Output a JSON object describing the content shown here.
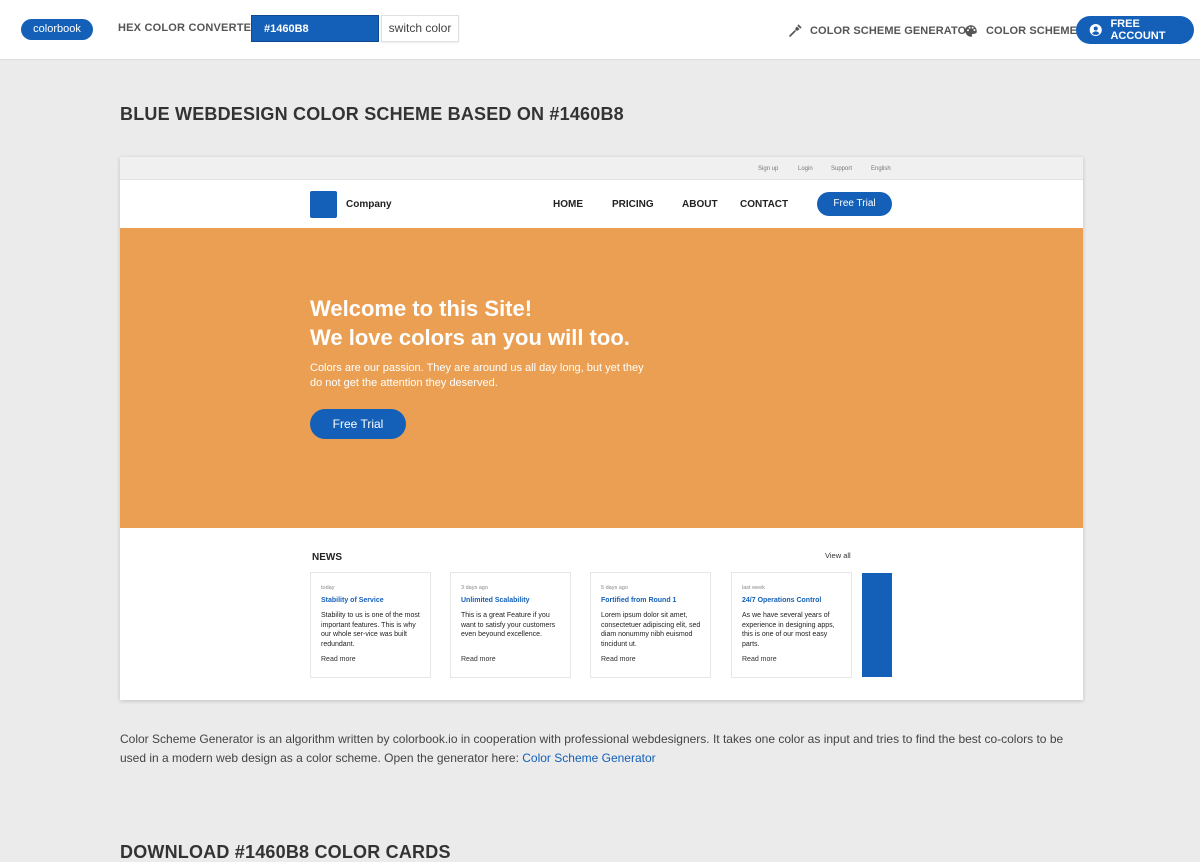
{
  "topnav": {
    "logo": "colorbook",
    "converter_label": "HEX COLOR CONVERTER",
    "hex_value": "#1460B8",
    "switch_label": "switch color",
    "scheme_generator": "COLOR SCHEME GENERATOR",
    "color_schemes": "COLOR SCHEMES",
    "free_account": "FREE ACCOUNT"
  },
  "page_title": "BLUE WEBDESIGN COLOR SCHEME BASED ON #1460B8",
  "preview": {
    "util_links": [
      "Sign up",
      "Login",
      "Support",
      "English"
    ],
    "brand": "Company",
    "nav": [
      "HOME",
      "PRICING",
      "ABOUT",
      "CONTACT"
    ],
    "nav_cta": "Free Trial",
    "hero_title_1": "Welcome to this Site!",
    "hero_title_2": "We love colors an you will too.",
    "hero_text": "Colors are our passion. They are around us all day long, but yet they do not get the attention they deserved.",
    "hero_button": "Free Trial",
    "news_heading": "NEWS",
    "view_all": "View all",
    "cards": [
      {
        "date": "today",
        "title": "Stability of Service",
        "text": "Stability to us is one of the most important features. This is why our whole ser-vice was built redundant.",
        "more": "Read more"
      },
      {
        "date": "3 days ago",
        "title": "Unlimited Scalability",
        "text": "This is a great Feature if you want to satisfy your customers even beyound excellence.",
        "more": "Read more"
      },
      {
        "date": "5 days ago",
        "title": "Fortified from Round 1",
        "text": "Lorem ipsum dolor sit amet, consectetuer adipiscing elit, sed diam nonummy nibh euismod tincidunt ut.",
        "more": "Read more"
      },
      {
        "date": "last week",
        "title": "24/7 Operations Control",
        "text": "As we have several years of experience in designing apps, this is one of our most easy parts.",
        "more": "Read more"
      }
    ]
  },
  "description": {
    "text": "Color Scheme Generator is an algorithm written by colorbook.io in cooperation with professional webdesigners. It takes one color as input and tries to find the best co-colors to be used in a modern web design as a color scheme. Open the generator here: ",
    "link": "Color Scheme Generator"
  },
  "download_title": "DOWNLOAD #1460B8 COLOR CARDS",
  "colors": {
    "primary": "#1460b8",
    "accent": "#eb9f52",
    "background": "#ebebeb"
  }
}
